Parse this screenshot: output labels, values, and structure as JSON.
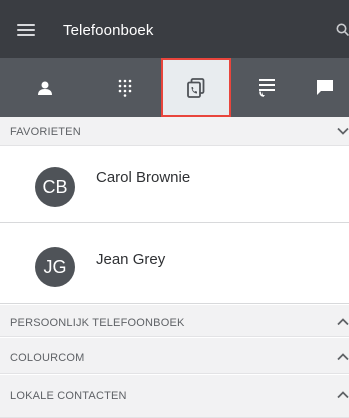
{
  "header": {
    "title": "Telefoonboek",
    "menu_icon": "hamburger-menu-icon",
    "search_icon": "search-icon"
  },
  "tabs": [
    {
      "icon": "person-icon",
      "selected": false
    },
    {
      "icon": "dialpad-icon",
      "selected": false
    },
    {
      "icon": "phonebook-icon",
      "selected": true
    },
    {
      "icon": "call-history-icon",
      "selected": false
    },
    {
      "icon": "chat-icon",
      "selected": false
    }
  ],
  "favorites": {
    "label": "FAVORIETEN",
    "expanded": true,
    "contacts": [
      {
        "initials": "CB",
        "name": "Carol Brownie"
      },
      {
        "initials": "JG",
        "name": "Jean Grey"
      }
    ]
  },
  "sections": [
    {
      "label": "PERSOONLIJK TELEFOONBOEK",
      "expanded": false
    },
    {
      "label": "COLOURCOM",
      "expanded": false
    },
    {
      "label": "LOKALE CONTACTEN",
      "expanded": false
    }
  ],
  "colors": {
    "appbar": "#3a3d42",
    "tabbar": "#54585e",
    "selected_tab_border": "#e8453c",
    "avatar": "#4f5358"
  }
}
